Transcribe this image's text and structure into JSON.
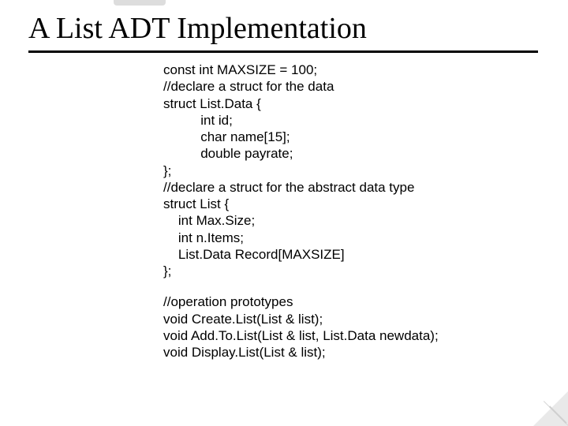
{
  "title": "A List ADT Implementation",
  "code": {
    "l0": "const int MAXSIZE = 100;",
    "l1": "//declare a struct for the data",
    "l2": "struct List.Data {",
    "l3": "          int id;",
    "l4": "          char name[15];",
    "l5": "          double payrate;",
    "l6": "};",
    "l7": "//declare a struct for the abstract data type",
    "l8": "struct List {",
    "l9": "    int Max.Size;",
    "l10": "    int n.Items;",
    "l11": "    List.Data Record[MAXSIZE]",
    "l12": "};",
    "l13": "//operation prototypes",
    "l14": "void Create.List(List & list);",
    "l15": "void Add.To.List(List & list, List.Data newdata);",
    "l16": "void Display.List(List & list);"
  }
}
